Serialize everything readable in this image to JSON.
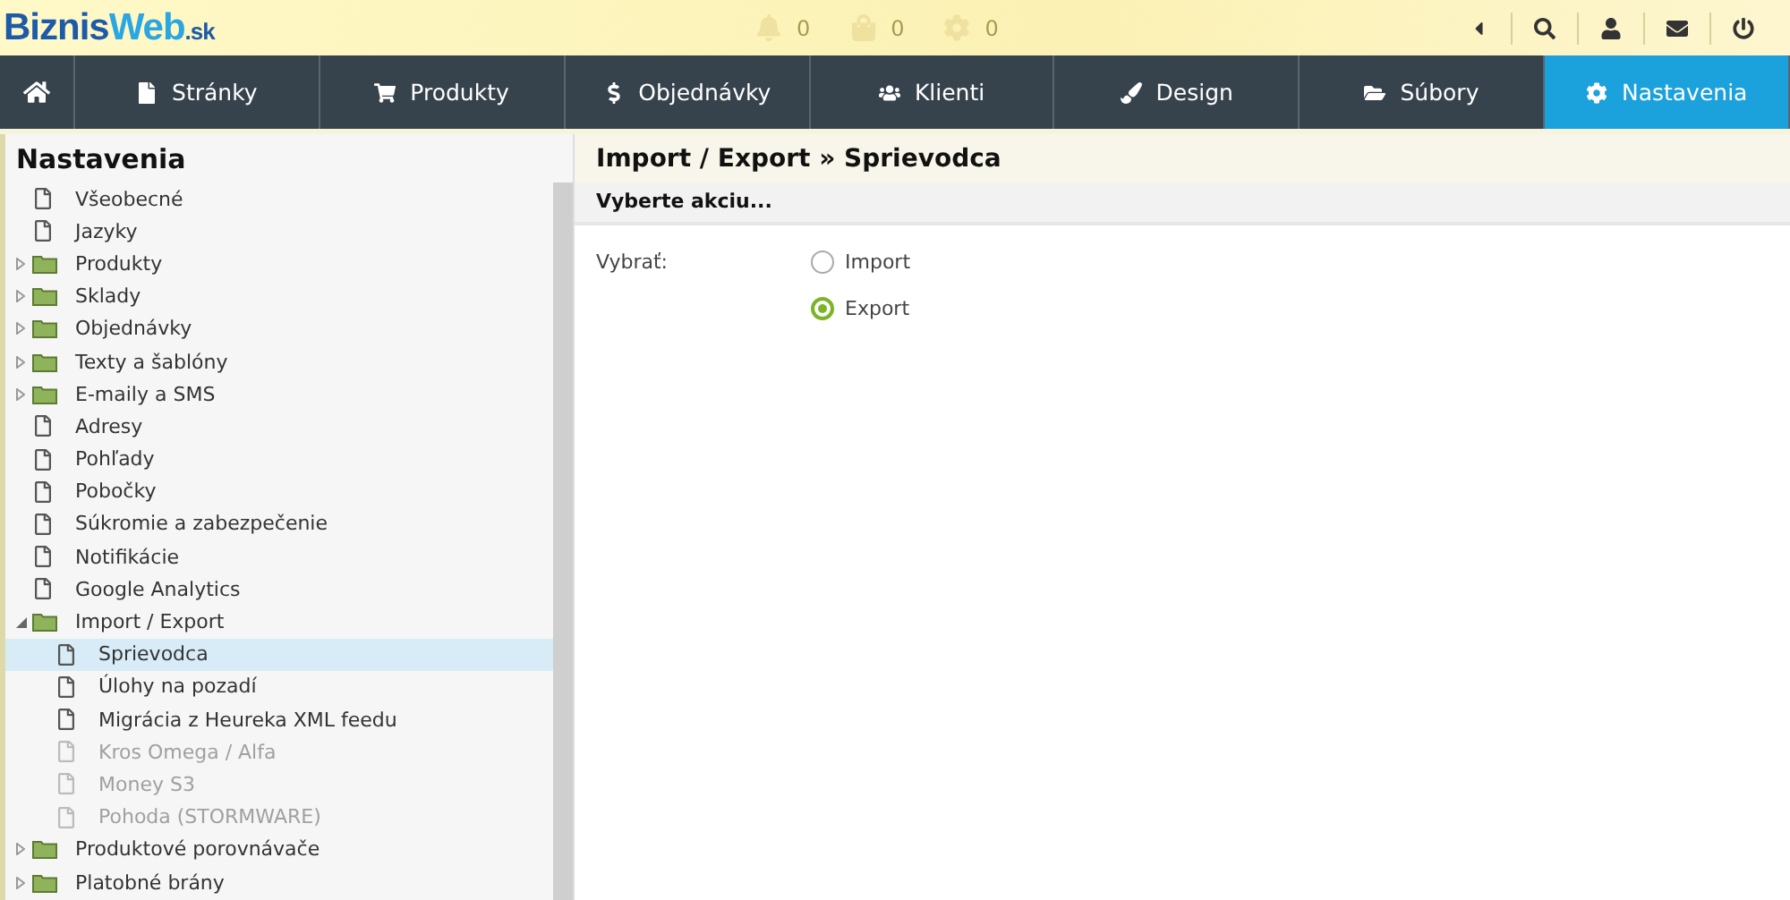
{
  "logo": {
    "first": "Biznis",
    "second": "Web",
    "suffix": ".sk"
  },
  "notifications": [
    {
      "kind": "bell",
      "count": "0"
    },
    {
      "kind": "bag",
      "count": "0"
    },
    {
      "kind": "gear",
      "count": "0"
    }
  ],
  "tools": [
    {
      "kind": "collapse"
    },
    {
      "kind": "search"
    },
    {
      "kind": "user"
    },
    {
      "kind": "mail"
    },
    {
      "kind": "power"
    }
  ],
  "nav": [
    {
      "kind": "home",
      "selected": false
    },
    {
      "kind": "page",
      "label": "Stránky",
      "selected": false
    },
    {
      "kind": "cart",
      "label": "Produkty",
      "selected": false
    },
    {
      "kind": "dollar",
      "label": "Objednávky",
      "selected": false
    },
    {
      "kind": "users",
      "label": "Klienti",
      "selected": false
    },
    {
      "kind": "brush",
      "label": "Design",
      "selected": false
    },
    {
      "kind": "folder",
      "label": "Súbory",
      "selected": false
    },
    {
      "kind": "gear",
      "label": "Nastavenia",
      "selected": true
    }
  ],
  "sidebar": {
    "title": "Nastavenia",
    "items": [
      {
        "kind": "file",
        "label": "Všeobecné",
        "selected": false,
        "disabled": false
      },
      {
        "kind": "file",
        "label": "Jazyky",
        "selected": false,
        "disabled": false
      },
      {
        "kind": "folder",
        "label": "Produkty",
        "expanded": false
      },
      {
        "kind": "folder",
        "label": "Sklady",
        "expanded": false
      },
      {
        "kind": "folder",
        "label": "Objednávky",
        "expanded": false
      },
      {
        "kind": "folder",
        "label": "Texty a šablóny",
        "expanded": false
      },
      {
        "kind": "folder",
        "label": "E-maily a SMS",
        "expanded": false
      },
      {
        "kind": "file",
        "label": "Adresy",
        "selected": false,
        "disabled": false
      },
      {
        "kind": "file",
        "label": "Pohľady",
        "selected": false,
        "disabled": false
      },
      {
        "kind": "file",
        "label": "Pobočky",
        "selected": false,
        "disabled": false
      },
      {
        "kind": "file",
        "label": "Súkromie a zabezpečenie",
        "selected": false,
        "disabled": false
      },
      {
        "kind": "file",
        "label": "Notifikácie",
        "selected": false,
        "disabled": false
      },
      {
        "kind": "file",
        "label": "Google Analytics",
        "selected": false,
        "disabled": false
      },
      {
        "kind": "folder",
        "label": "Import / Export",
        "expanded": true,
        "children": [
          {
            "kind": "file",
            "label": "Sprievodca",
            "selected": true,
            "disabled": false
          },
          {
            "kind": "file",
            "label": "Úlohy na pozadí",
            "selected": false,
            "disabled": false
          },
          {
            "kind": "file",
            "label": "Migrácia z Heureka XML feedu",
            "selected": false,
            "disabled": false
          },
          {
            "kind": "file",
            "label": "Kros Omega / Alfa",
            "selected": false,
            "disabled": true
          },
          {
            "kind": "file",
            "label": "Money S3",
            "selected": false,
            "disabled": true
          },
          {
            "kind": "file",
            "label": "Pohoda (STORMWARE)",
            "selected": false,
            "disabled": true
          }
        ]
      },
      {
        "kind": "folder",
        "label": "Produktové porovnávače",
        "expanded": false
      },
      {
        "kind": "folder",
        "label": "Platobné brány",
        "expanded": false
      }
    ]
  },
  "main": {
    "title": "Import / Export » Sprievodca",
    "section": "Vyberte akciu...",
    "field_label": "Vybrať:",
    "options": [
      {
        "label": "Import",
        "selected": false
      },
      {
        "label": "Export",
        "selected": true
      }
    ]
  }
}
